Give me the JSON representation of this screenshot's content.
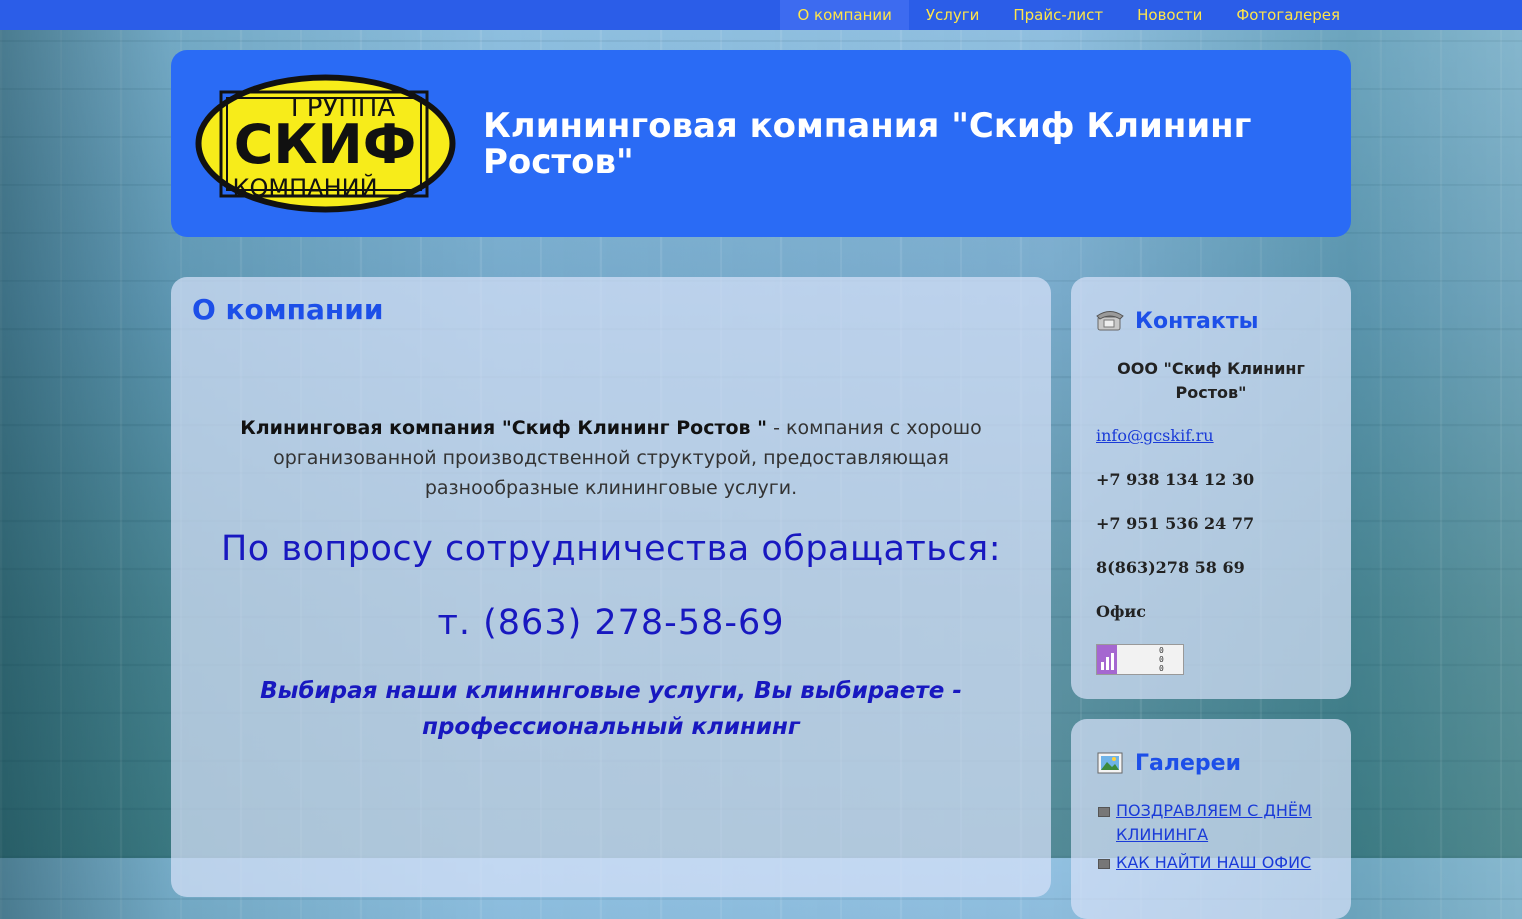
{
  "nav": {
    "items": [
      {
        "label": "О компании",
        "active": true
      },
      {
        "label": "Услуги"
      },
      {
        "label": "Прайс-лист"
      },
      {
        "label": "Новости"
      },
      {
        "label": "Фотогалерея"
      }
    ]
  },
  "header": {
    "logo": {
      "line1": "ГРУППА",
      "line2": "СКИФ",
      "line3": "КОМПАНИЙ"
    },
    "title": "Клининговая компания \"Скиф Клининг Ростов\""
  },
  "main": {
    "title": "О компании",
    "intro_bold": "Клининговая компания \"Скиф Клининг Ростов \"",
    "intro_rest": " - компания с хорошо организованной производственной структурой, предоставляющая разнообразные клининговые услуги.",
    "cooperation": "По вопросу сотрудничества  обращаться:",
    "phone": "т. (863) 278-58-69",
    "slogan": "Выбирая наши клининговые услуги, Вы выбираете - профессиональный клининг"
  },
  "contacts": {
    "title": "Контакты",
    "company": "ООО \"Скиф Клининг Ростов\"",
    "email": "info@gcskif.ru",
    "phone1": "+7 938 134 12 30",
    "phone2": "+7 951 536 24 77",
    "phone3": "8(863)278 58 69",
    "office": "Офис",
    "counter": {
      "row1": "0",
      "row2": "0",
      "row3": "0"
    }
  },
  "galleries": {
    "title": "Галереи",
    "items": [
      "Поздравляем с днём клининга",
      "Как найти наш офис"
    ]
  },
  "colors": {
    "nav_bg": "#2b5de8",
    "nav_text": "#ffe54a",
    "header_bg": "#2a6bf5",
    "heading_blue": "#1d4fe8",
    "accent_text": "#1818c0"
  }
}
